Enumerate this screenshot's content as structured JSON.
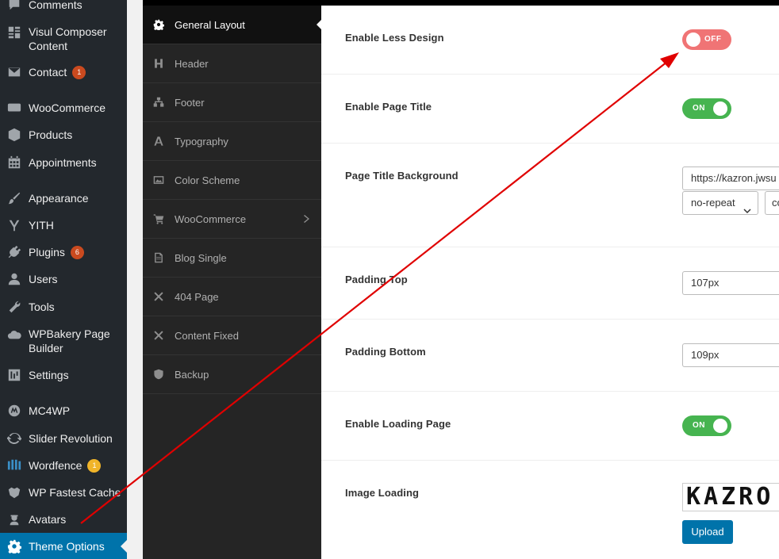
{
  "wp_menu": [
    {
      "label": "Comments",
      "icon": "comment-icon"
    },
    {
      "label": "Visul Composer Content",
      "icon": "grid-icon"
    },
    {
      "label": "Contact",
      "icon": "mail-icon",
      "badge": "1"
    },
    {
      "label": "WooCommerce",
      "icon": "woocommerce-icon"
    },
    {
      "label": "Products",
      "icon": "box-icon"
    },
    {
      "label": "Appointments",
      "icon": "calendar-icon"
    },
    {
      "label": "Appearance",
      "icon": "paintbrush-icon"
    },
    {
      "label": "YITH",
      "icon": "yith-icon"
    },
    {
      "label": "Plugins",
      "icon": "plug-icon",
      "badge": "6"
    },
    {
      "label": "Users",
      "icon": "user-icon"
    },
    {
      "label": "Tools",
      "icon": "wrench-icon"
    },
    {
      "label": "WPBakery Page Builder",
      "icon": "cloud-icon"
    },
    {
      "label": "Settings",
      "icon": "sliders-icon"
    },
    {
      "label": "MC4WP",
      "icon": "mailchimp-icon"
    },
    {
      "label": "Slider Revolution",
      "icon": "refresh-icon"
    },
    {
      "label": "Wordfence",
      "icon": "wordfence-icon",
      "badge": "1"
    },
    {
      "label": "WP Fastest Cache",
      "icon": "cheetah-icon"
    },
    {
      "label": "Avatars",
      "icon": "avatar-icon"
    },
    {
      "label": "Theme Options",
      "icon": "gear-icon",
      "active": true
    }
  ],
  "options_nav": [
    {
      "label": "General Layout",
      "icon": "gear-icon",
      "active": true
    },
    {
      "label": "Header",
      "icon": "header-icon"
    },
    {
      "label": "Footer",
      "icon": "sitemap-icon"
    },
    {
      "label": "Typography",
      "icon": "font-icon"
    },
    {
      "label": "Color Scheme",
      "icon": "image-icon"
    },
    {
      "label": "WooCommerce",
      "icon": "cart-icon",
      "submenu": true
    },
    {
      "label": "Blog Single",
      "icon": "file-icon"
    },
    {
      "label": "404 Page",
      "icon": "times-icon"
    },
    {
      "label": "Content Fixed",
      "icon": "times-icon"
    },
    {
      "label": "Backup",
      "icon": "shield-icon"
    }
  ],
  "settings": {
    "enable_less_design": {
      "label": "Enable Less Design",
      "state": "OFF"
    },
    "enable_page_title": {
      "label": "Enable Page Title",
      "state": "ON"
    },
    "page_title_background": {
      "label": "Page Title Background",
      "url": "https://kazron.jwsu",
      "repeat": "no-repeat",
      "second_select": "co"
    },
    "padding_top": {
      "label": "Padding Top",
      "value": "107px"
    },
    "padding_bottom": {
      "label": "Padding Bottom",
      "value": "109px"
    },
    "enable_loading_page": {
      "label": "Enable Loading Page",
      "state": "ON"
    },
    "image_loading": {
      "label": "Image Loading",
      "preview_text": "KAZRO",
      "upload_label": "Upload"
    }
  },
  "colors": {
    "wp_sidebar": "#23282d",
    "wp_active": "#0073aa",
    "toggle_on": "#46b450",
    "toggle_off": "#f07475",
    "annotation_arrow": "#e00000"
  }
}
